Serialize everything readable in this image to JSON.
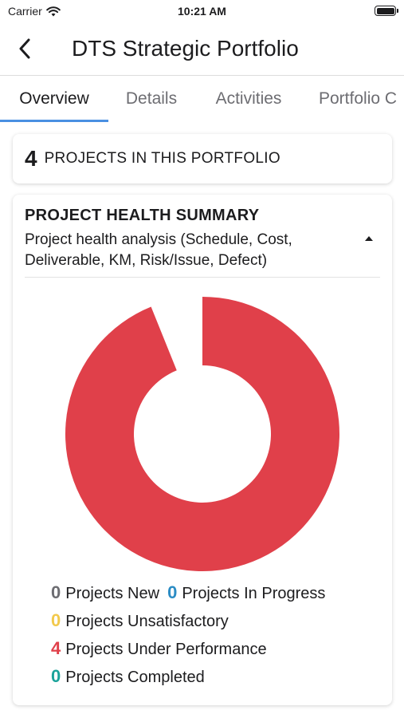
{
  "status_bar": {
    "carrier": "Carrier",
    "time": "10:21 AM"
  },
  "nav": {
    "title": "DTS Strategic Portfolio"
  },
  "tabs": [
    {
      "label": "Overview"
    },
    {
      "label": "Details"
    },
    {
      "label": "Activities"
    },
    {
      "label": "Portfolio C"
    }
  ],
  "summary": {
    "count": "4",
    "label": "PROJECTS IN THIS PORTFOLIO"
  },
  "health": {
    "title": "PROJECT HEALTH SUMMARY",
    "description": "Project health analysis (Schedule, Cost, Deliverable, KM, Risk/Issue, Defect)"
  },
  "legend": {
    "new": {
      "count": "0",
      "label": "Projects New",
      "color": "#6d6d72"
    },
    "in_progress": {
      "count": "0",
      "label": "Projects In Progress",
      "color": "#2b8cc4"
    },
    "unsatisfactory": {
      "count": "0",
      "label": "Projects Unsatisfactory",
      "color": "#f2c94c"
    },
    "under_performance": {
      "count": "4",
      "label": "Projects Under Performance",
      "color": "#e0404a"
    },
    "completed": {
      "count": "0",
      "label": "Projects Completed",
      "color": "#1aa39a"
    }
  },
  "chart_data": {
    "type": "pie",
    "categories": [
      "Projects New",
      "Projects In Progress",
      "Projects Unsatisfactory",
      "Projects Under Performance",
      "Projects Completed"
    ],
    "values": [
      0,
      0,
      0,
      4,
      0
    ],
    "colors": [
      "#6d6d72",
      "#2b8cc4",
      "#f2c94c",
      "#e0404a",
      "#1aa39a"
    ]
  }
}
